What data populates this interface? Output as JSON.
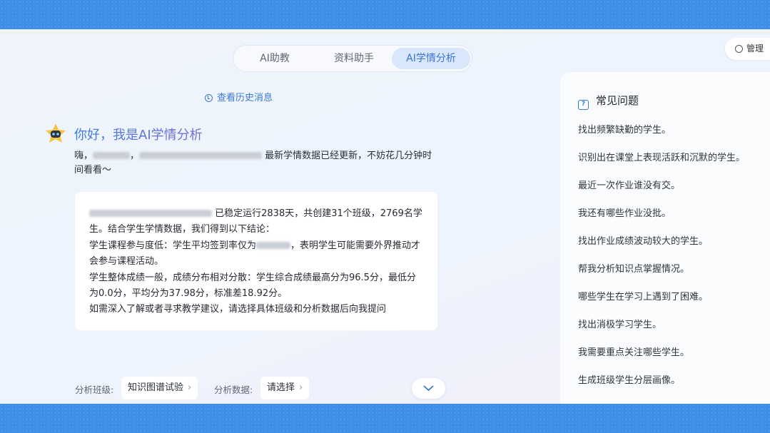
{
  "tabs": [
    {
      "label": "AI助教"
    },
    {
      "label": "资料助手"
    },
    {
      "label": "AI学情分析",
      "active": true
    }
  ],
  "manage": {
    "label": "管理",
    "icon": "gear-icon"
  },
  "history": {
    "label": "查看历史消息",
    "icon": "history-icon"
  },
  "greeting": {
    "title": "你好，我是AI学情分析",
    "hi": "嗨，",
    "comma": "，",
    "text": "最新学情数据已经更新，不妨花几分钟时间看看～"
  },
  "summary": {
    "line1": "已稳定运行2838天，共创建31个班级，2769名学生。结合学生学情数据，我们得到以下结论：",
    "line2a": "学生课程参与度低：学生平均签到率仅为",
    "line2b": "，表明学生可能需要外界推动才会参与课程活动。",
    "line3": "学生整体成绩一般，成绩分布相对分散：学生综合成绩最高分为96.5分，最低分为0.0分，平均分为37.98分，标准差18.92分。",
    "line4": "如需深入了解或者寻求教学建议，请选择具体班级和分析数据后向我提问"
  },
  "footer": {
    "class_label": "分析班级:",
    "class_value": "知识图谱试验",
    "data_label": "分析数据:",
    "data_value": "请选择"
  },
  "faq": {
    "title": "常见问题",
    "items": [
      "找出频繁缺勤的学生。",
      "识别出在课堂上表现活跃和沉默的学生。",
      "最近一次作业谁没有交。",
      "我还有哪些作业没批。",
      "找出作业成绩波动较大的学生。",
      "帮我分析知识点掌握情况。",
      "哪些学生在学习上遇到了困难。",
      "找出消极学习学生。",
      "我需要重点关注哪些学生。",
      "生成班级学生分层画像。"
    ]
  },
  "colors": {
    "accent": "#3a78d8",
    "band": "#3f8ee8"
  }
}
